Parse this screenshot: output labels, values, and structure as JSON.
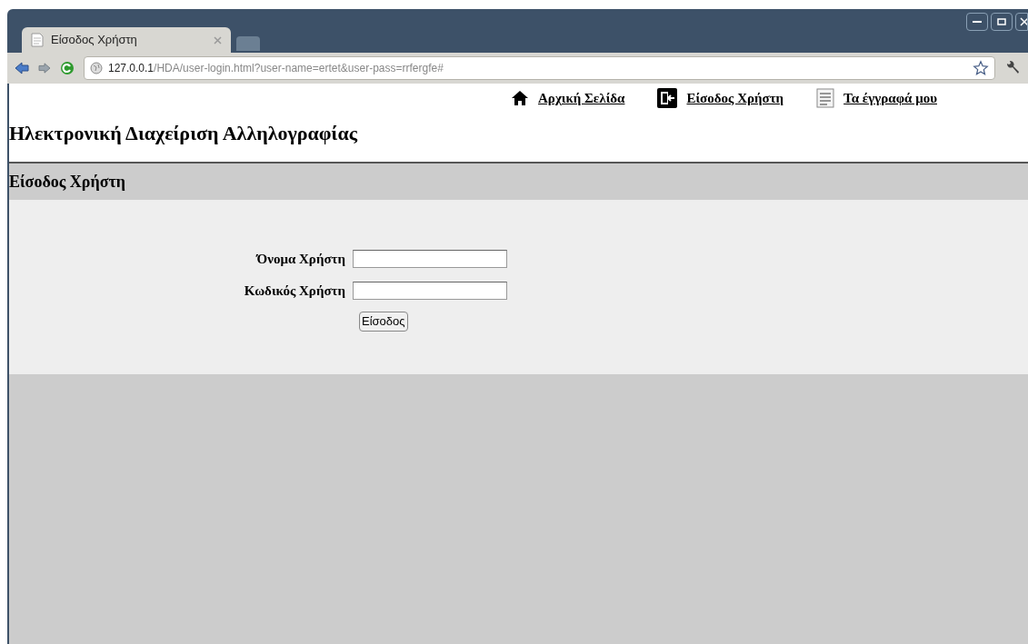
{
  "browser": {
    "tab_title": "Είσοδος Χρήστη",
    "url_host": "127.0.0.1",
    "url_path": "/HDA/user-login.html?user-name=ertet&user-pass=rrfergfe#"
  },
  "nav": [
    {
      "kind": "home",
      "label": "Αρχική Σελίδα"
    },
    {
      "kind": "login",
      "label": "Είσοδος Χρήστη"
    },
    {
      "kind": "documents",
      "label": "Τα έγγραφά μου"
    }
  ],
  "site_title": "Ηλεκτρονική Διαχείριση Αλληλογραφίας",
  "section_title": "Είσοδος Χρήστη",
  "form": {
    "fields": [
      {
        "label": "Όνομα Χρήστη"
      },
      {
        "label": "Κωδικός Χρήστη"
      }
    ],
    "submit": "Είσοδος"
  }
}
